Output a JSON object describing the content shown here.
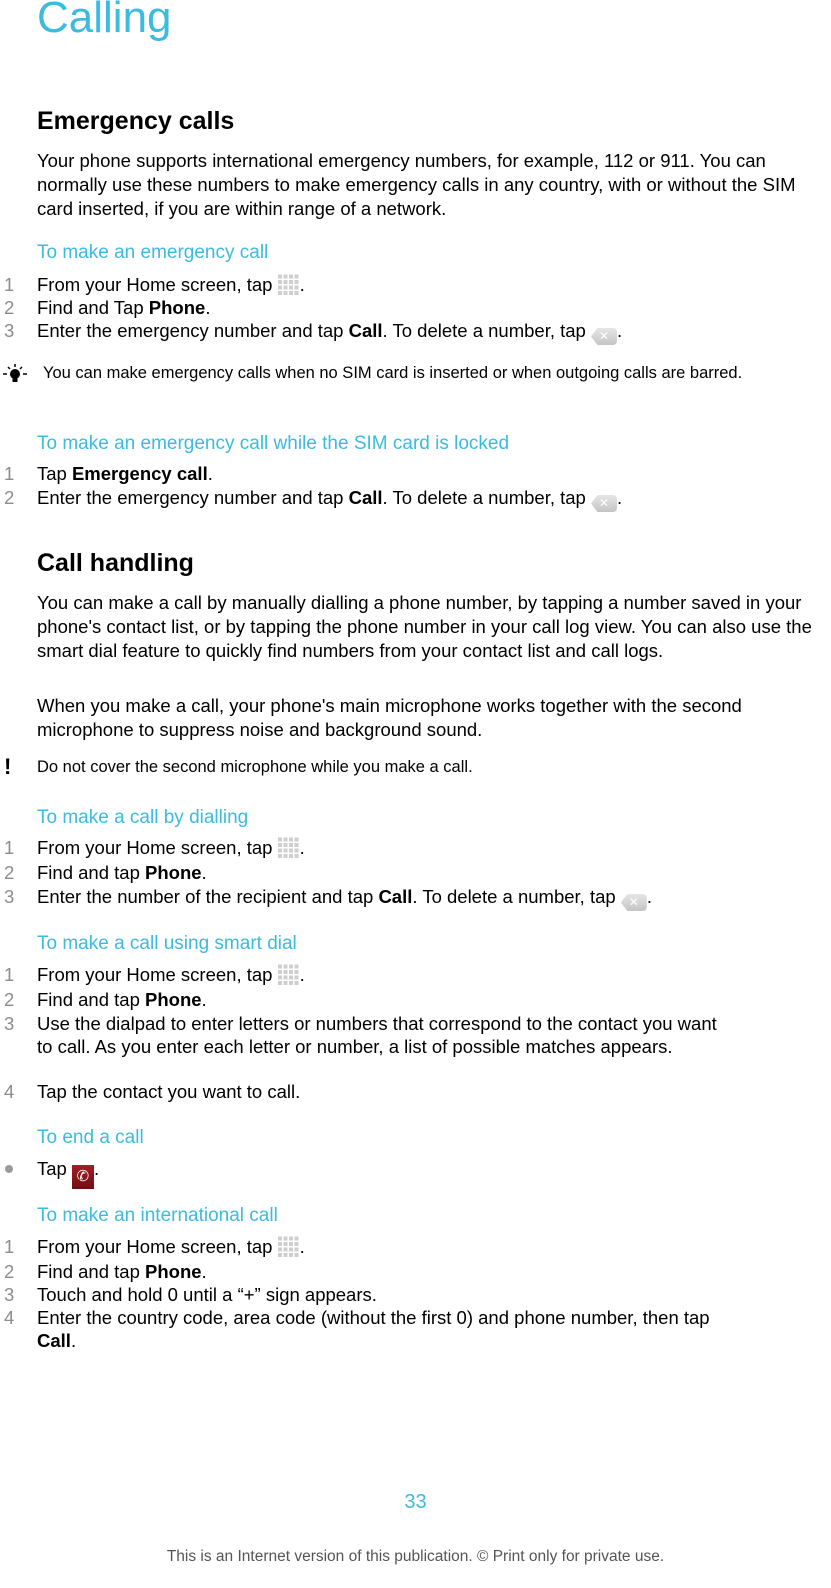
{
  "page": {
    "title": "Calling",
    "page_number": "33",
    "footer": "This is an Internet version of this publication. © Print only for private use."
  },
  "sections": {
    "emergency": {
      "heading": "Emergency calls",
      "intro": "Your phone supports international emergency numbers, for example, 112 or 911. You can normally use these numbers to make emergency calls in any country, with or without the SIM card inserted, if you are within range of a network.",
      "task1": {
        "title": "To make an emergency call",
        "steps": [
          {
            "num": "1",
            "pre": "From your Home screen, tap ",
            "icon": "app-grid-icon",
            "post": "."
          },
          {
            "num": "2",
            "pre": "Find and Tap ",
            "bold": "Phone",
            "post": "."
          },
          {
            "num": "3",
            "pre": "Enter the emergency number and tap ",
            "bold": "Call",
            "mid": ". To delete a number, tap ",
            "icon": "backspace-icon",
            "post": "."
          }
        ]
      },
      "tip": "You can make emergency calls when no SIM card is inserted or when outgoing calls are barred.",
      "task2": {
        "title": "To make an emergency call while the SIM card is locked",
        "steps": [
          {
            "num": "1",
            "pre": "Tap ",
            "bold": "Emergency call",
            "post": "."
          },
          {
            "num": "2",
            "pre": "Enter the emergency number and tap ",
            "bold": "Call",
            "mid": ". To delete a number, tap ",
            "icon": "backspace-icon",
            "post": "."
          }
        ]
      }
    },
    "handling": {
      "heading": "Call handling",
      "intro1": "You can make a call by manually dialling a phone number, by tapping a number saved in your phone's contact list, or by tapping the phone number in your call log view. You can also use the smart dial feature to quickly find numbers from your contact list and call logs.",
      "intro2": "When you make a call, your phone's main microphone works together with the second microphone to suppress noise and background sound.",
      "warning": "Do not cover the second microphone while you make a call.",
      "task_dial": {
        "title": "To make a call by dialling",
        "steps": [
          {
            "num": "1",
            "pre": "From your Home screen, tap ",
            "icon": "app-grid-icon",
            "post": "."
          },
          {
            "num": "2",
            "pre": "Find and tap ",
            "bold": "Phone",
            "post": "."
          },
          {
            "num": "3",
            "pre": "Enter the number of the recipient and tap ",
            "bold": "Call",
            "mid": ". To delete a number, tap ",
            "icon": "backspace-icon",
            "post": "."
          }
        ]
      },
      "task_smart": {
        "title": "To make a call using smart dial",
        "steps": [
          {
            "num": "1",
            "pre": "From your Home screen, tap ",
            "icon": "app-grid-icon",
            "post": "."
          },
          {
            "num": "2",
            "pre": "Find and tap ",
            "bold": "Phone",
            "post": "."
          },
          {
            "num": "3",
            "text": "Use the dialpad to enter letters or numbers that correspond to the contact you want to call. As you enter each letter or number, a list of possible matches appears."
          },
          {
            "num": "4",
            "text": "Tap the contact you want to call."
          }
        ]
      },
      "task_end": {
        "title": "To end a call",
        "step": {
          "pre": "Tap ",
          "icon": "end-call-icon",
          "post": "."
        }
      },
      "task_intl": {
        "title": "To make an international call",
        "steps": [
          {
            "num": "1",
            "pre": "From your Home screen, tap ",
            "icon": "app-grid-icon",
            "post": "."
          },
          {
            "num": "2",
            "pre": "Find and tap ",
            "bold": "Phone",
            "post": "."
          },
          {
            "num": "3",
            "text": "Touch and hold 0 until a “+” sign appears."
          },
          {
            "num": "4",
            "pre": "Enter the country code, area code (without the first 0) and phone number, then tap ",
            "bold": "Call",
            "post": "."
          }
        ]
      }
    }
  },
  "colors": {
    "accent": "#3bbbe0",
    "step_number": "#8c8c8c",
    "end_call": "#a51f24"
  }
}
